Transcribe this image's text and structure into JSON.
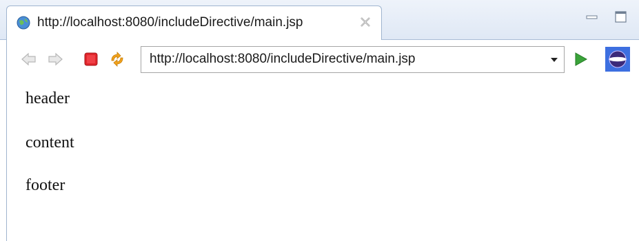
{
  "tab": {
    "title": "http://localhost:8080/includeDirective/main.jsp",
    "favicon": "globe-icon"
  },
  "toolbar": {
    "back_icon": "back-arrow-icon",
    "forward_icon": "forward-arrow-icon",
    "stop_icon": "stop-icon",
    "refresh_icon": "refresh-icon",
    "go_icon": "go-arrow-icon",
    "eclipse_icon": "eclipse-icon"
  },
  "address": {
    "value": "http://localhost:8080/includeDirective/main.jsp"
  },
  "page": {
    "header": "header",
    "content": "content",
    "footer": "footer"
  },
  "colors": {
    "stop": "#e0262c",
    "go": "#3aa33a",
    "tab_border": "#9fb4cf",
    "tabstrip_bg": "#dfe8f5"
  }
}
